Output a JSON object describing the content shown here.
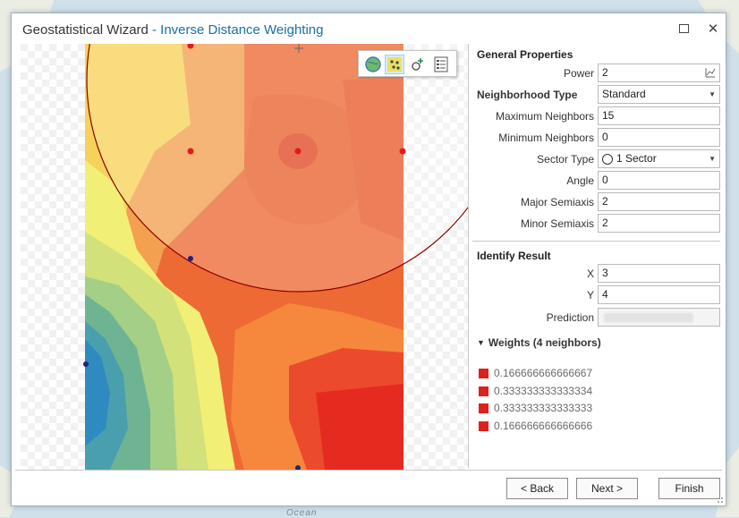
{
  "window": {
    "title": "Geostatistical Wizard",
    "subtitle": "- Inverse Distance Weighting",
    "maximize_icon": "maximize-icon",
    "close_icon": "close-icon"
  },
  "map_toolbar": {
    "tools": [
      "globe-icon",
      "points-icon",
      "add-point-icon",
      "legend-icon"
    ],
    "active_tool": "points-icon"
  },
  "background_label": "Ocean",
  "general_properties": {
    "heading": "General Properties",
    "power": {
      "label": "Power",
      "value": "2"
    },
    "neighborhood_type": {
      "label": "Neighborhood Type",
      "value": "Standard"
    },
    "max_neighbors": {
      "label": "Maximum Neighbors",
      "value": "15"
    },
    "min_neighbors": {
      "label": "Minimum Neighbors",
      "value": "0"
    },
    "sector_type": {
      "label": "Sector Type",
      "value": "1 Sector"
    },
    "angle": {
      "label": "Angle",
      "value": "0"
    },
    "major_semiaxis": {
      "label": "Major Semiaxis",
      "value": "2"
    },
    "minor_semiaxis": {
      "label": "Minor Semiaxis",
      "value": "2"
    }
  },
  "identify_result": {
    "heading": "Identify Result",
    "x": {
      "label": "X",
      "value": "3"
    },
    "y": {
      "label": "Y",
      "value": "4"
    },
    "prediction": {
      "label": "Prediction",
      "value": ""
    }
  },
  "weights": {
    "heading": "Weights (4 neighbors)",
    "values": [
      "0.166666666666667",
      "0.333333333333334",
      "0.333333333333333",
      "0.166666666666666"
    ],
    "swatch_color": "#e0201b"
  },
  "buttons": {
    "back": "< Back",
    "next": "Next >",
    "finish": "Finish"
  },
  "colors": {
    "accent": "#1b6fa8",
    "neighbor_point": "#e41a1c",
    "data_point": "#1a237e"
  }
}
